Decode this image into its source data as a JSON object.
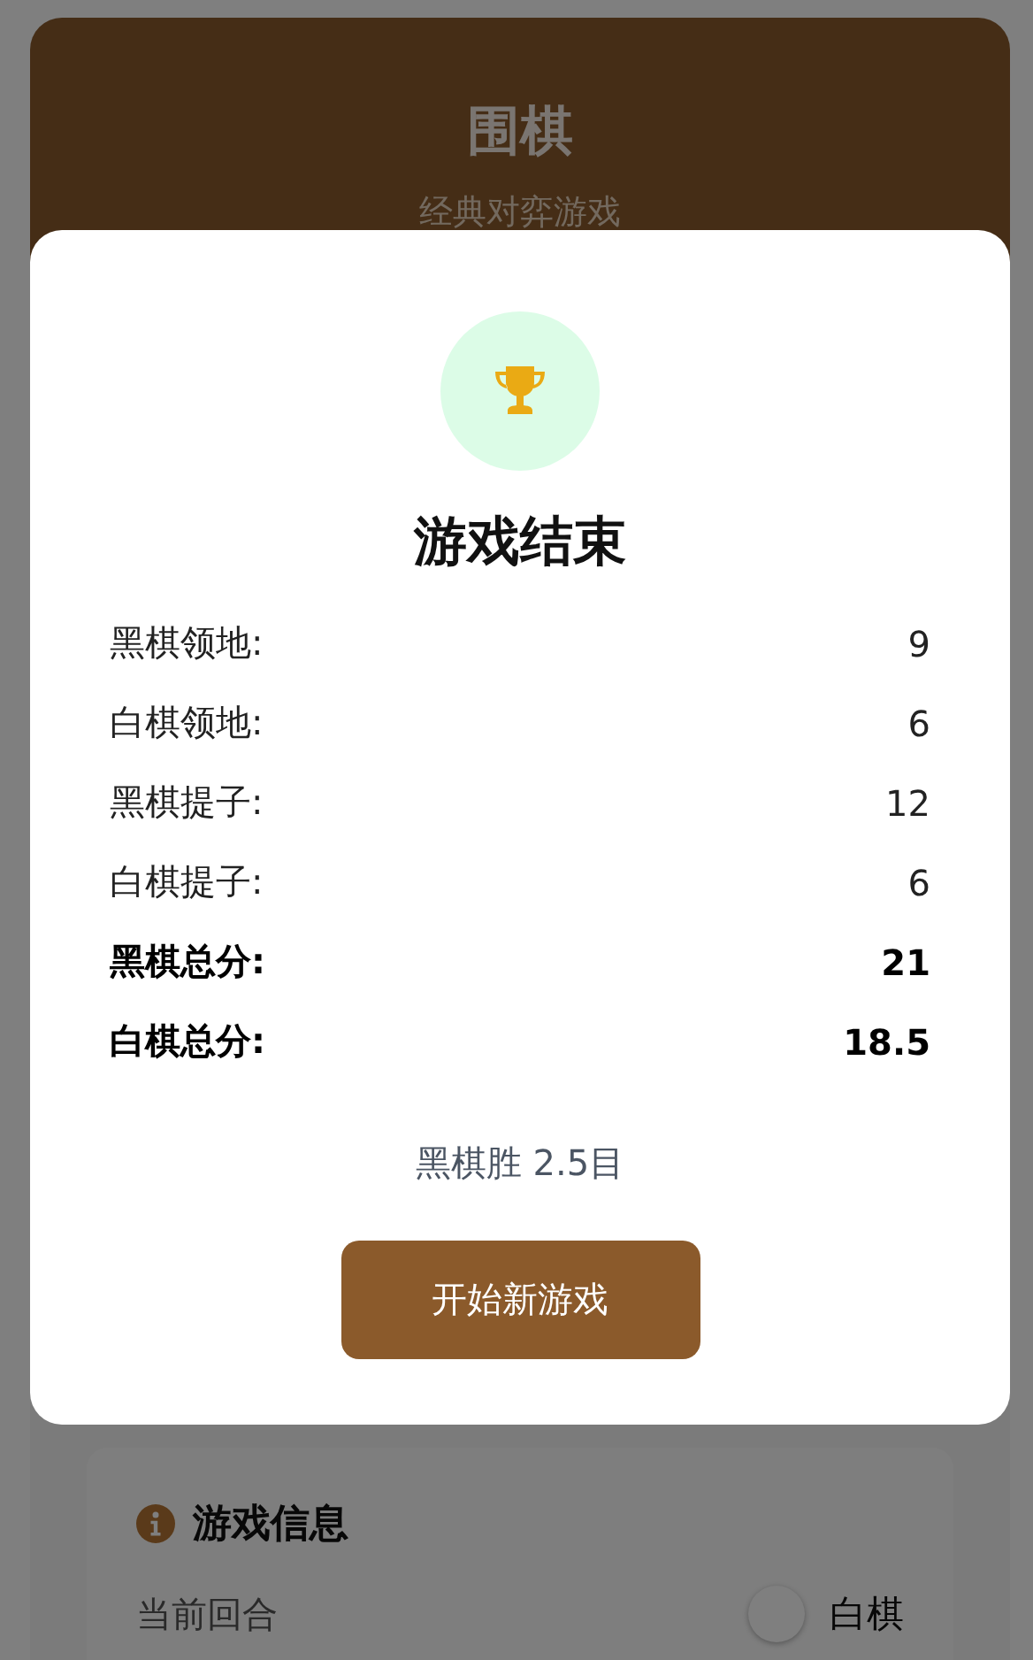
{
  "header": {
    "title": "围棋",
    "subtitle": "经典对弈游戏"
  },
  "game_info": {
    "title": "游戏信息",
    "current_turn": {
      "label": "当前回合",
      "color": "#7f7f7f",
      "value": "白棋"
    }
  },
  "dialog": {
    "title": "游戏结束",
    "scores": [
      {
        "label": "黑棋领地:",
        "value": "9",
        "total": false
      },
      {
        "label": "白棋领地:",
        "value": "6",
        "total": false
      },
      {
        "label": "黑棋提子:",
        "value": "12",
        "total": false
      },
      {
        "label": "白棋提子:",
        "value": "6",
        "total": false
      },
      {
        "label": "黑棋总分:",
        "value": "21",
        "total": true
      },
      {
        "label": "白棋总分:",
        "value": "18.5",
        "total": true
      }
    ],
    "result": "黑棋胜 2.5目",
    "button": "开始新游戏"
  }
}
